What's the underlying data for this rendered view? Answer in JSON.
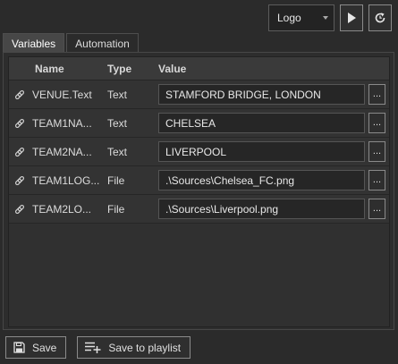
{
  "toolbar": {
    "preset_select": {
      "selected": "Logo"
    },
    "icons": [
      "play-icon",
      "refresh-icon",
      "chevron-down-icon"
    ]
  },
  "tabs": [
    {
      "label": "Variables",
      "active": true
    },
    {
      "label": "Automation",
      "active": false
    }
  ],
  "grid": {
    "columns": {
      "name": "Name",
      "type": "Type",
      "value": "Value"
    },
    "rows": [
      {
        "name": "VENUE.Text",
        "type": "Text",
        "value": "STAMFORD BRIDGE, LONDON",
        "browse_label": "..."
      },
      {
        "name": "TEAM1NA...",
        "type": "Text",
        "value": "CHELSEA",
        "browse_label": "..."
      },
      {
        "name": "TEAM2NA...",
        "type": "Text",
        "value": "LIVERPOOL",
        "browse_label": "..."
      },
      {
        "name": "TEAM1LOG...",
        "type": "File",
        "value": ".\\Sources\\Chelsea_FC.png",
        "browse_label": "..."
      },
      {
        "name": "TEAM2LO...",
        "type": "File",
        "value": ".\\Sources\\Liverpool.png",
        "browse_label": "..."
      }
    ]
  },
  "footer": {
    "save_label": "Save",
    "save_playlist_label": "Save to playlist"
  }
}
